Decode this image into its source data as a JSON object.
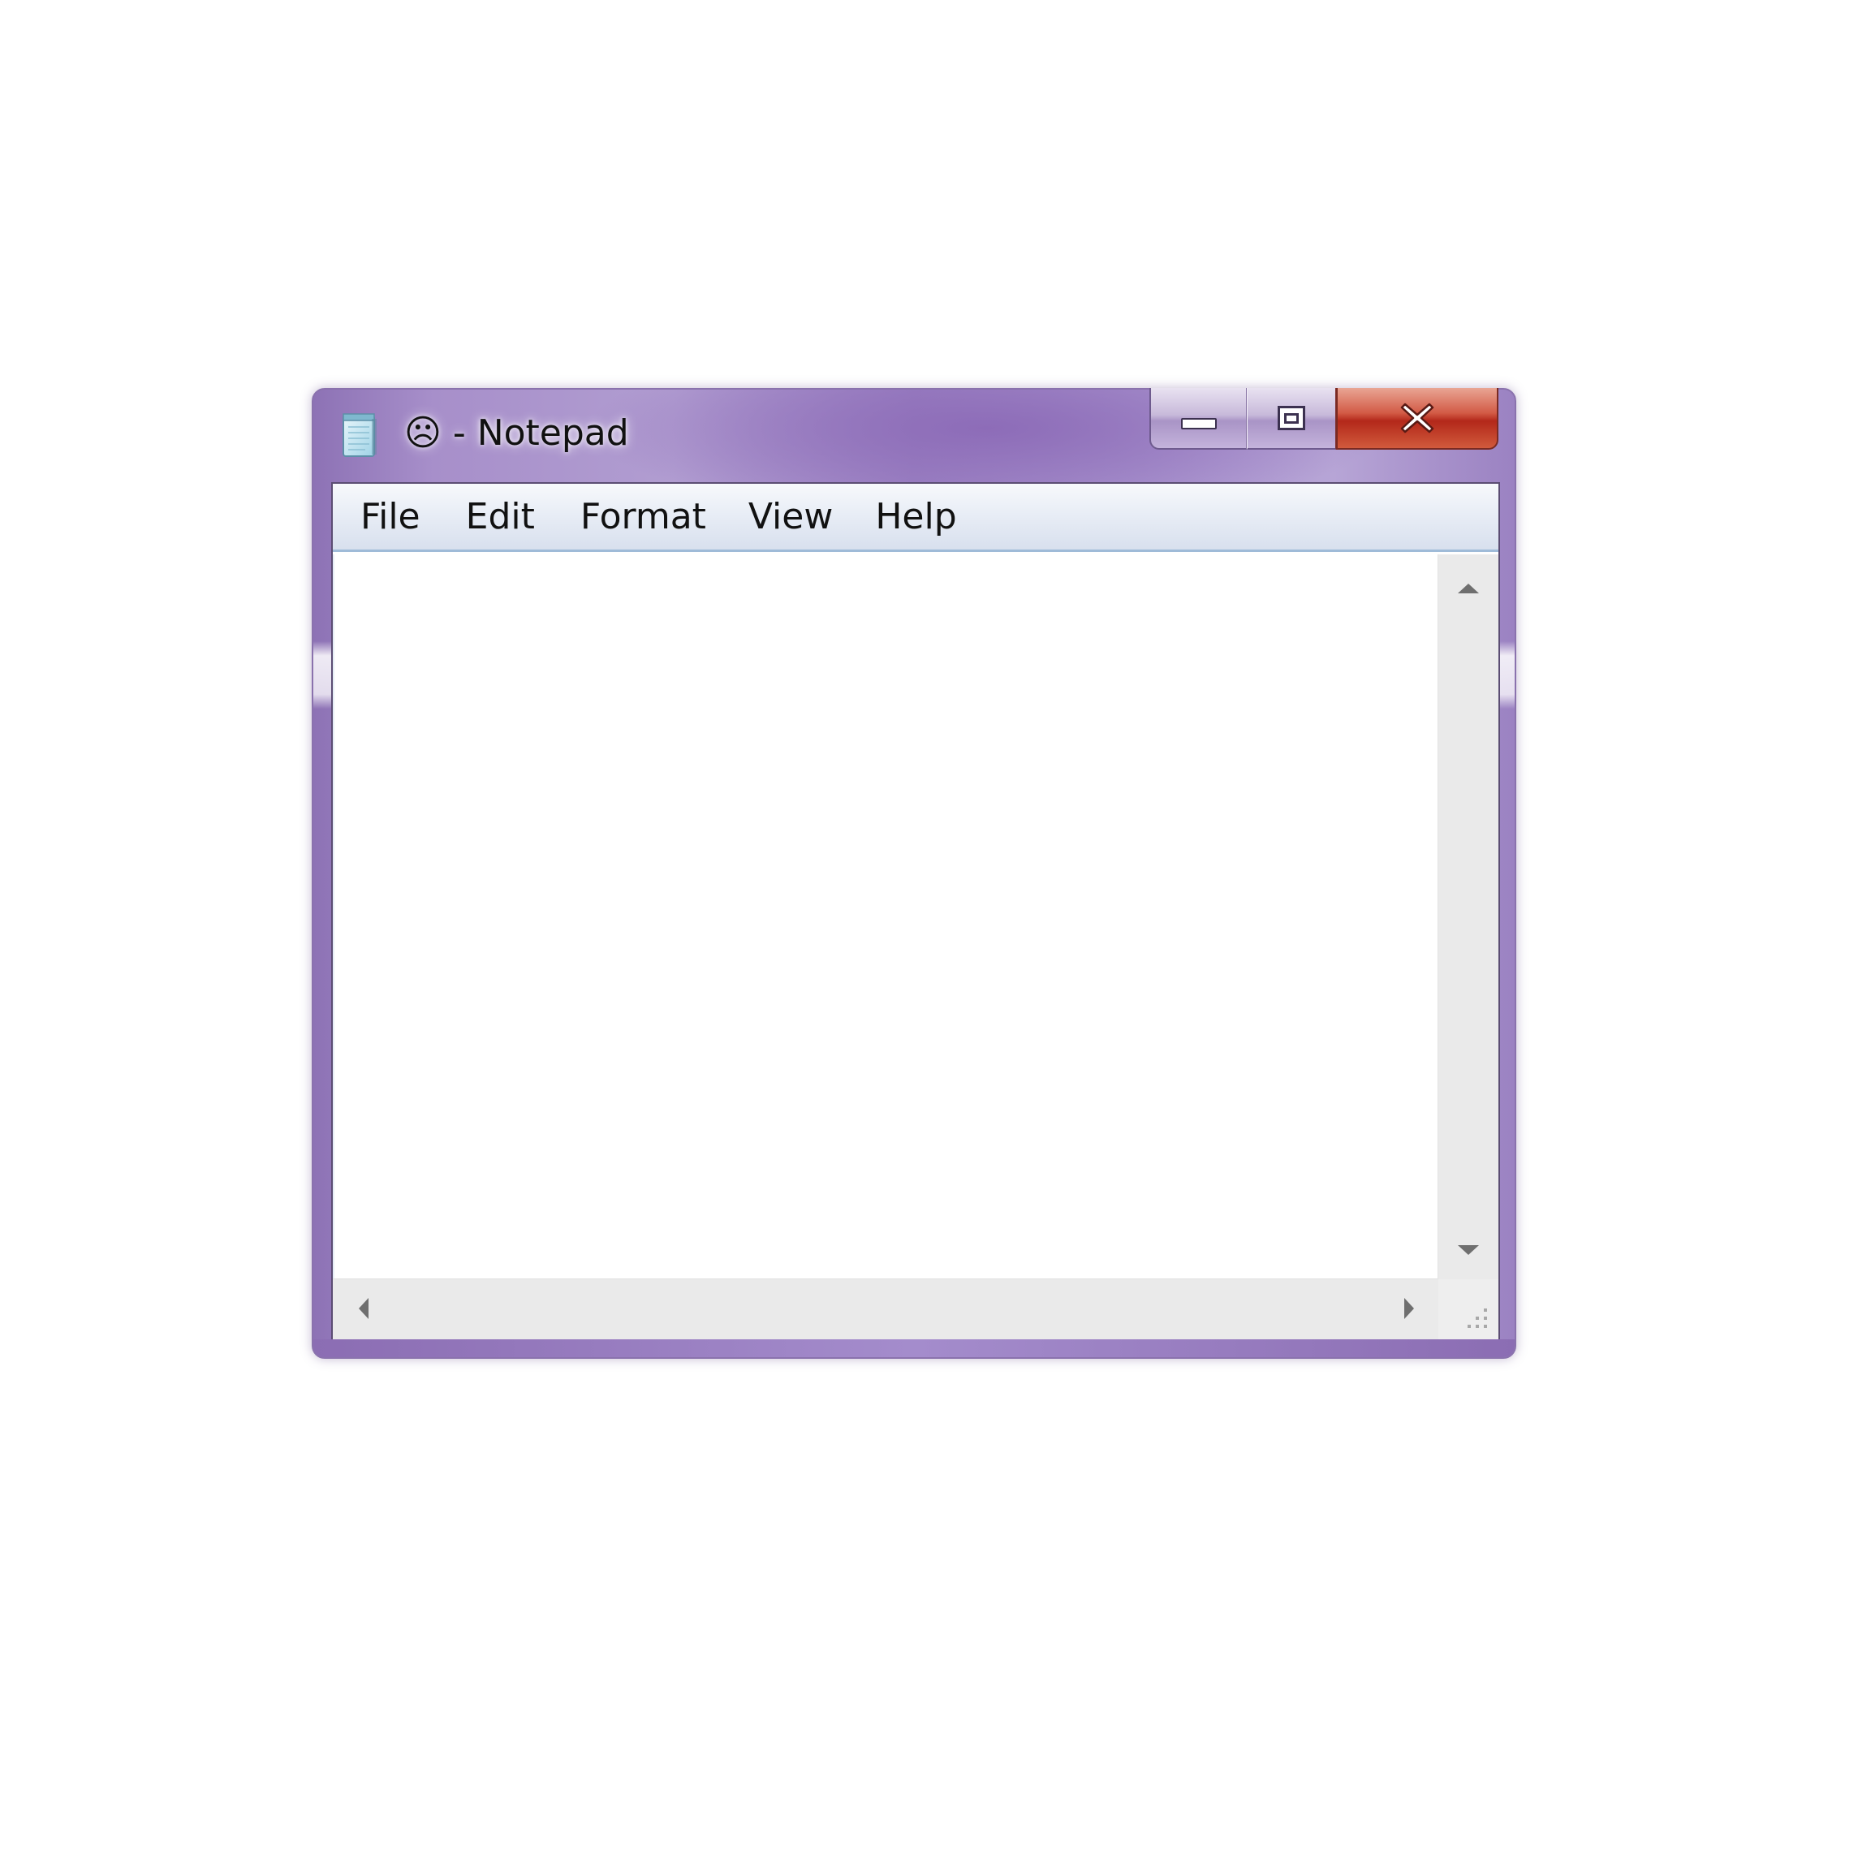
{
  "window": {
    "title": "☹ - Notepad",
    "app_icon": "notepad-icon"
  },
  "caption_buttons": {
    "minimize_icon": "minimize-icon",
    "maximize_icon": "maximize-icon",
    "close_icon": "close-icon"
  },
  "menu": {
    "items": [
      {
        "label": "File"
      },
      {
        "label": "Edit"
      },
      {
        "label": "Format"
      },
      {
        "label": "View"
      },
      {
        "label": "Help"
      }
    ]
  },
  "editor": {
    "content": ""
  },
  "colors": {
    "frame": "#a48ccc",
    "close_button": "#c7402c",
    "menubar": "#e7ecf5"
  }
}
